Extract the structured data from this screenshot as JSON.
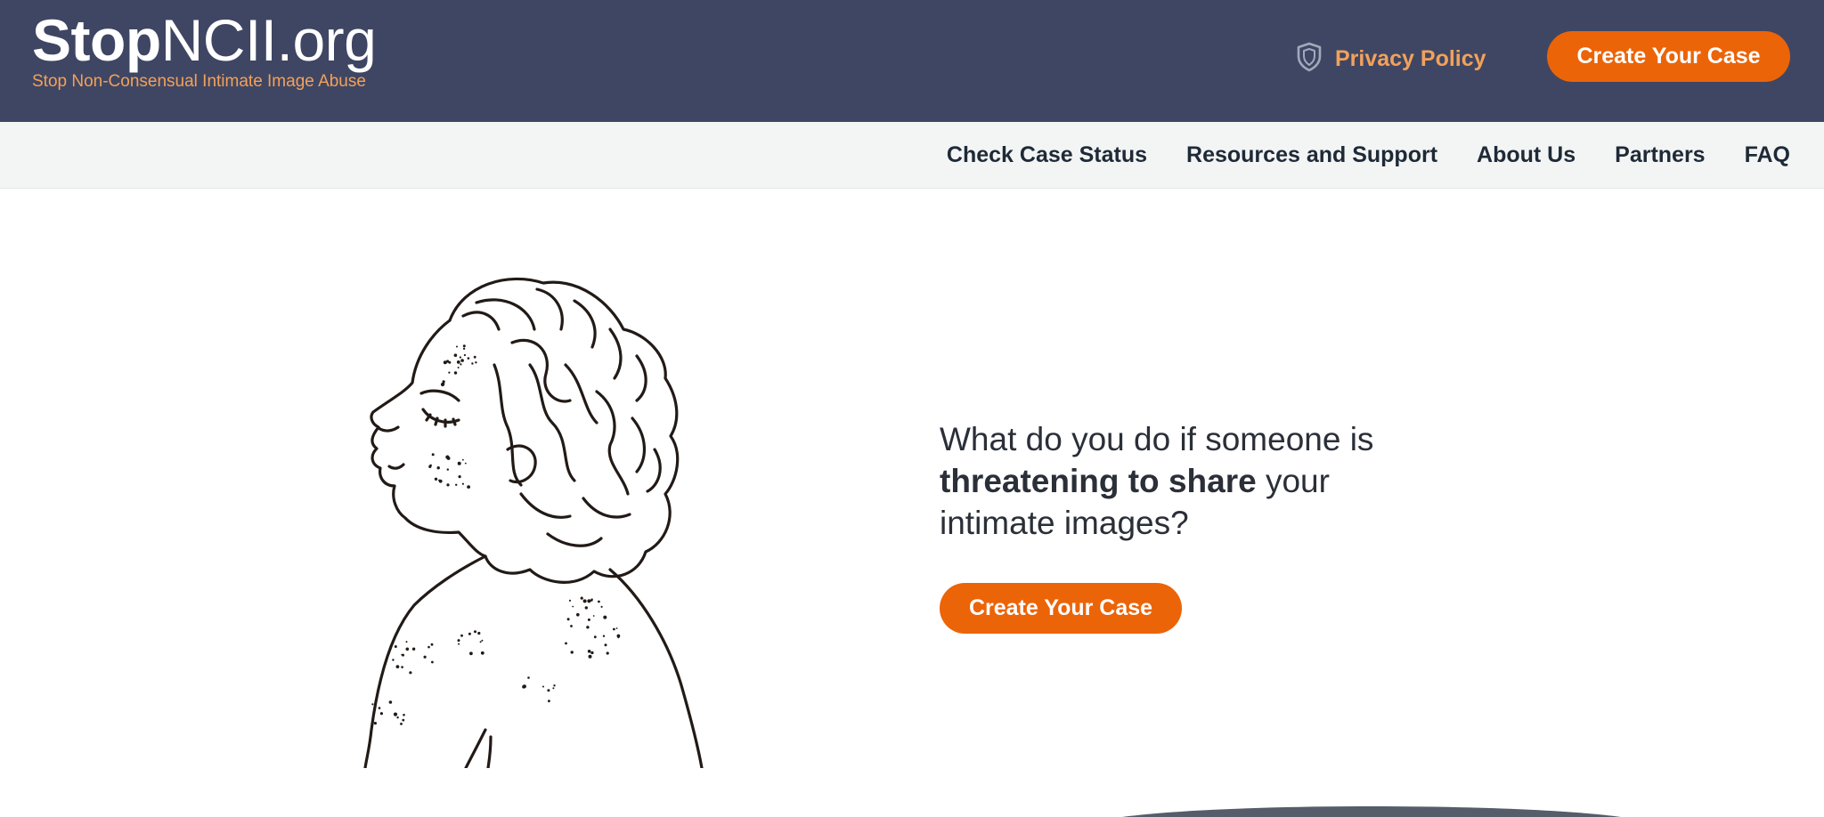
{
  "brand": {
    "logo_bold": "Stop",
    "logo_light": "NCII.org",
    "tagline": "Stop Non-Consensual Intimate Image Abuse"
  },
  "header": {
    "privacy_label": "Privacy Policy",
    "privacy_icon": "shield-icon",
    "cta_label": "Create Your Case"
  },
  "nav": {
    "items": [
      {
        "label": "Check Case Status"
      },
      {
        "label": "Resources and Support"
      },
      {
        "label": "About Us"
      },
      {
        "label": "Partners"
      },
      {
        "label": "FAQ"
      }
    ]
  },
  "hero": {
    "question_start": "What do you do if someone is",
    "question_bold": "threatening to share",
    "question_end": "your intimate images?",
    "cta_label": "Create Your Case"
  },
  "colors": {
    "header_bg": "#3f4663",
    "accent_orange": "#ec6408",
    "accent_light_orange": "#f2a15a",
    "nav_bg": "#f3f5f5"
  }
}
